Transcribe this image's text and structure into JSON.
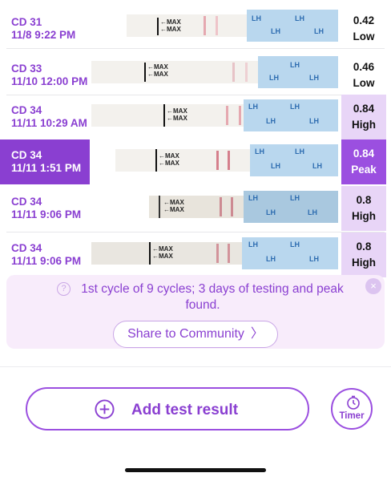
{
  "tests": [
    {
      "cycle_day": "CD 31",
      "datetime": "11/8 9:22 PM",
      "value": "0.42",
      "level": "Low"
    },
    {
      "cycle_day": "CD 33",
      "datetime": "11/10 12:00 PM",
      "value": "0.46",
      "level": "Low"
    },
    {
      "cycle_day": "CD 34",
      "datetime": "11/11 10:29 AM",
      "value": "0.84",
      "level": "High"
    },
    {
      "cycle_day": "CD 34",
      "datetime": "11/11 1:51 PM",
      "value": "0.84",
      "level": "Peak"
    },
    {
      "cycle_day": "CD 34",
      "datetime": "11/11 9:06 PM",
      "value": "0.8",
      "level": "High"
    },
    {
      "cycle_day": "CD 34",
      "datetime": "11/11 9:06 PM",
      "value": "0.8",
      "level": "High"
    }
  ],
  "strip": {
    "max_label": "MAX",
    "lh_label": "LH"
  },
  "banner": {
    "message": "1st cycle of 9 cycles; 3 days of testing and peak found.",
    "share_label": "Share to Community",
    "share_chevron": "〉",
    "close_glyph": "×",
    "info_glyph": "?"
  },
  "actions": {
    "add_label": "Add test result",
    "timer_label": "Timer"
  },
  "colors": {
    "accent": "#8a3fd1",
    "peak": "#9b4fe0",
    "pale": "#e8d5f7"
  }
}
